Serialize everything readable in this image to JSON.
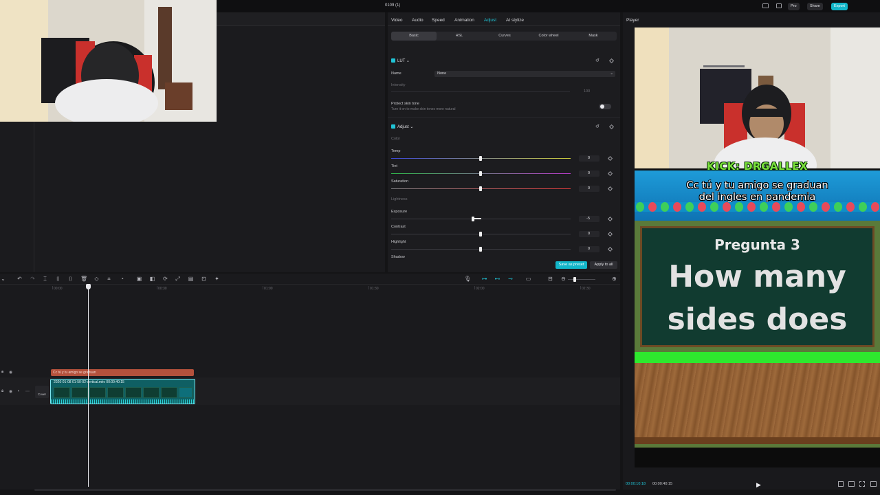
{
  "app": {
    "doc_title": "0109 (1)",
    "top_buttons": {
      "pro": "Pro",
      "share": "Share",
      "export": "Export"
    }
  },
  "inspector": {
    "tabs": [
      "Video",
      "Audio",
      "Speed",
      "Animation",
      "Adjust",
      "AI stylize"
    ],
    "active_tab": "Adjust",
    "subtabs": [
      "Basic",
      "HSL",
      "Curves",
      "Color wheel",
      "Mask"
    ],
    "active_subtab": "Basic",
    "lut": {
      "header": "LUT",
      "name_label": "Name",
      "name_value": "None",
      "intensity_label": "Intensity",
      "intensity_value": "100",
      "protect_label": "Protect skin tone",
      "protect_hint": "Turn it on to make skin tones more natural"
    },
    "adjust": {
      "header": "Adjust",
      "color_group": "Color",
      "temp_label": "Temp",
      "temp_value": "0",
      "tint_label": "Tint",
      "tint_value": "0",
      "saturation_label": "Saturation",
      "saturation_value": "0",
      "lightness_group": "Lightness",
      "exposure_label": "Exposure",
      "exposure_value": "-5",
      "contrast_label": "Contrast",
      "contrast_value": "0",
      "highlight_label": "Highlight",
      "highlight_value": "0",
      "shadow_label": "Shadow"
    },
    "save_preset": "Save as preset",
    "apply_all": "Apply to all"
  },
  "player": {
    "label": "Player",
    "kick_text": "KICK: DRGALLEX",
    "caption_line1": "Cc tú y tu amigo se graduan",
    "caption_line2": "del ingles en pandemia",
    "pregunta": "Pregunta 3",
    "question_line1": "How many",
    "question_line2": "sides does",
    "time_current": "00:00:10:18",
    "time_total": "00:00:40:15"
  },
  "timeline": {
    "ruler": [
      "00:00",
      "00:30",
      "01:00",
      "01:30",
      "02:00",
      "02:30"
    ],
    "text_clip": "Cc tú y tu amigo se graduan",
    "video_clip": "2026-01-08 01-50-02-vertical.mkv   00:00:40:15",
    "cover_label": "Cover"
  },
  "colors": {
    "accent": "#20c4d6",
    "export": "#12b6c9",
    "text_clip": "#b4513c",
    "video_clip": "#0f5f63"
  }
}
